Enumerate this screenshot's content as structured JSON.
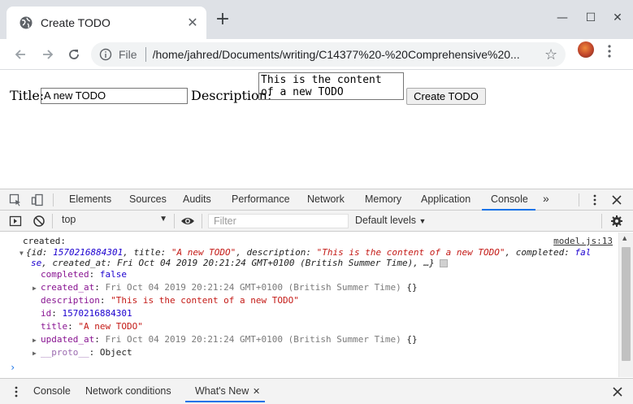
{
  "browser": {
    "tab_title": "Create TODO",
    "tab_close": "✕",
    "new_tab": "+",
    "window_controls": [
      "—",
      "☐",
      "✕"
    ],
    "url_scheme_label": "File",
    "url": "/home/jahred/Documents/writing/C14377%20-%20Comprehensive%20..."
  },
  "page": {
    "title_label": "Title:",
    "title_value": "A new TODO",
    "description_label": "Description:",
    "description_value": "This is the content\nof a new TODO",
    "create_button": "Create TODO"
  },
  "devtools": {
    "tabs": [
      "Elements",
      "Sources",
      "Audits",
      "Performance",
      "Network",
      "Memory",
      "Application",
      "Console"
    ],
    "active_tab": "Console",
    "more_tabs": "»",
    "context": "top",
    "filter_placeholder": "Filter",
    "levels": "Default levels",
    "console": {
      "source": "model.js:13",
      "log_label": "created:",
      "summary_line1_a": "{id: ",
      "summary_id": "1570216884301",
      "summary_line1_b": ", title: ",
      "summary_title": "\"A new TODO\"",
      "summary_line1_c": ", description: ",
      "summary_desc": "\"This is the content of a new TODO\"",
      "summary_line1_d": ", completed: ",
      "summary_completed_a": "fal",
      "summary_completed_b": "se",
      "summary_line2_b": ", created_at: Fri Oct 04 2019 20:21:24 GMT+0100 (British Summer Time), …}",
      "props": [
        {
          "key": "completed",
          "value": "false",
          "type": "num",
          "expandable": false
        },
        {
          "key": "created_at",
          "value": "Fri Oct 04 2019 20:21:24 GMT+0100 (British Summer Time)",
          "suffix": " {}",
          "type": "dim",
          "expandable": true
        },
        {
          "key": "description",
          "value": "\"This is the content of a new TODO\"",
          "type": "str",
          "expandable": false
        },
        {
          "key": "id",
          "value": "1570216884301",
          "type": "num",
          "expandable": false
        },
        {
          "key": "title",
          "value": "\"A new TODO\"",
          "type": "str",
          "expandable": false
        },
        {
          "key": "updated_at",
          "value": "Fri Oct 04 2019 20:21:24 GMT+0100 (British Summer Time)",
          "suffix": " {}",
          "type": "dim",
          "expandable": true
        },
        {
          "key": "__proto__",
          "value": "Object",
          "type": "plain",
          "expandable": true
        }
      ],
      "prompt": "›"
    },
    "drawer_tabs": [
      "Console",
      "Network conditions",
      "What's New"
    ],
    "drawer_active": "What's New",
    "drawer_close": "✕"
  }
}
